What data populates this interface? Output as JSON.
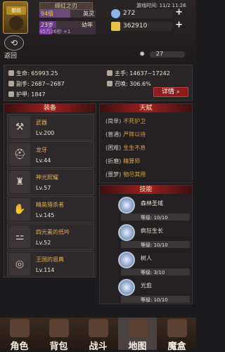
{
  "header": {
    "title": "绯红之刃",
    "status_time": "游戏时间: 11/2 11:26",
    "level": "94级",
    "class": "英灵",
    "age": "23岁",
    "life_stage": "幼年",
    "xp": "45万36秒 +1",
    "rank_badge": "御前"
  },
  "resources": {
    "gems": "272",
    "gold": "362910",
    "energy": "27"
  },
  "nav_back": "返回",
  "stats": {
    "hp": "生命: 65993.25",
    "atk": "主手: 14637~17242",
    "def": "副手: 2687~2687",
    "summon": "召唤: 306.6%",
    "armor": "护甲: 1847",
    "detail": "详情"
  },
  "equip": {
    "title": "装备",
    "items": [
      {
        "name": "武器",
        "lv": "Lv.200"
      },
      {
        "name": "龙牙",
        "lv": "Lv.44"
      },
      {
        "name": "神光照耀",
        "lv": "Lv.57"
      },
      {
        "name": "精英猎杀者",
        "lv": "Lv.145"
      },
      {
        "name": "四元素的低吟",
        "lv": "Lv.52"
      },
      {
        "name": "王国的恩典",
        "lv": "Lv.114"
      }
    ]
  },
  "talent": {
    "title": "天赋",
    "rows": [
      {
        "k": "(简单)",
        "v": "不死护卫"
      },
      {
        "k": "(普通)",
        "v": "严阵以待"
      },
      {
        "k": "(困难)",
        "v": "生生不息"
      },
      {
        "k": "(折磨)",
        "v": "精算师"
      },
      {
        "k": "(噩梦)",
        "v": "物尽其用"
      }
    ]
  },
  "skills": {
    "title": "技能",
    "items": [
      {
        "name": "森林圣域",
        "lv": "等级: 10/10"
      },
      {
        "name": "疯狂生长",
        "lv": "等级: 10/10"
      },
      {
        "name": "树人",
        "lv": "等级: 3/10"
      },
      {
        "name": "光愈",
        "lv": "等级: 10/10"
      }
    ]
  },
  "nav": {
    "items": [
      "角色",
      "背包",
      "战斗",
      "地图",
      "魔盒"
    ]
  }
}
